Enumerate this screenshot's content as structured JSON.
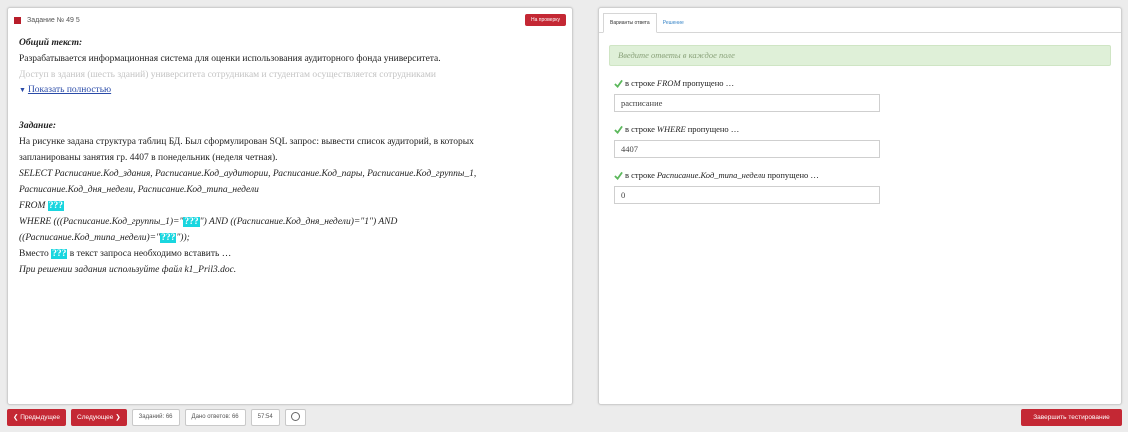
{
  "task": {
    "title": "Задание № 49 5",
    "report_label": "На проверку"
  },
  "content": {
    "general_title": "Общий текст:",
    "general_line1": "Разрабатывается информационная система для оценки использования аудиторного фонда университета.",
    "general_line2": "Доступ в здания (шесть зданий) университета сотрудникам и студентам осуществляется сотрудниками",
    "show_more": "Показать полностью",
    "task_title": "Задание:",
    "task_line1": "На рисунке задана структура таблиц БД. Был сформулирован SQL запрос: вывести список аудиторий, в которых",
    "task_line2": "запланированы занятия гр. 4407 в понедельник (неделя четная).",
    "sql_line1": "SELECT Расписание.Код_здания, Расписание.Код_аудитории, Расписание.Код_пары, Расписание.Код_группы_1,",
    "sql_line2": "Расписание.Код_дня_недели, Расписание.Код_типа_недели",
    "sql_from": "FROM ",
    "placeholder": "???",
    "sql_where_a": "WHERE (((Расписание.Код_группы_1)=\"",
    "sql_where_b": "\") AND ((Расписание.Код_дня_недели)=\"1\") AND",
    "sql_where_c": "((Расписание.Код_типа_недели)=\"",
    "sql_where_d": "\"));",
    "instead_a": "Вместо ",
    "instead_b": " в текст запроса необходимо вставить …",
    "file_note": "При решении задания используйте файл k1_Pril3.doc."
  },
  "tabs": [
    "Варианты ответа",
    "Решение"
  ],
  "hint": "Введите ответы в каждое поле",
  "questions": [
    {
      "label_prefix": "в строке ",
      "label_keyword": "FROM",
      "label_suffix": " пропущено …",
      "value": "расписание"
    },
    {
      "label_prefix": "в строке ",
      "label_keyword": "WHERE",
      "label_suffix": "  пропущено …",
      "value": "4407"
    },
    {
      "label_prefix": "в строке ",
      "label_keyword": "Расписание.Код_типа_недели",
      "label_suffix": " пропущено …",
      "value": "0"
    }
  ],
  "bottom": {
    "prev_label": "❮ Предыдущее",
    "next_label": "Следующее ❯",
    "tasks_count": "Заданий: 66",
    "answered": "Дано ответов: 66",
    "timer": "57:54",
    "finish_label": "Завершить тестирование"
  },
  "colors": {
    "brand_red": "#c42834",
    "highlight_cyan": "#19d6df",
    "hint_green_bg": "#dff0d8",
    "check_green": "#5cb85c",
    "link_blue": "#2a4ba8"
  }
}
